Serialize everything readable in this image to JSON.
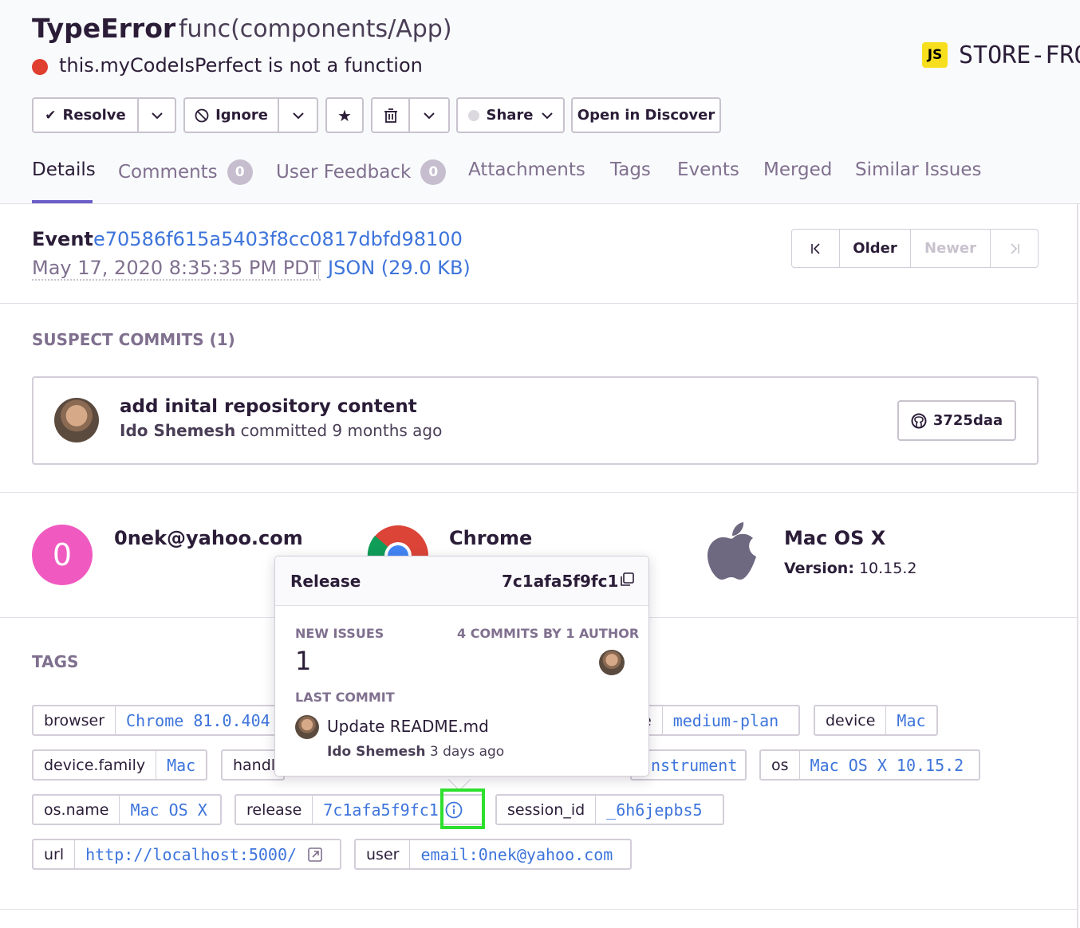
{
  "header": {
    "error_type": "TypeError",
    "culprit": "func(components/App)",
    "message": "this.myCodeIsPerfect is not a function",
    "project_badge": "JS",
    "project_name": "STORE-FRO"
  },
  "actions": {
    "resolve": "Resolve",
    "ignore": "Ignore",
    "share": "Share",
    "open_in_discover": "Open in Discover"
  },
  "tabs": [
    {
      "label": "Details"
    },
    {
      "label": "Comments",
      "count": "0"
    },
    {
      "label": "User Feedback",
      "count": "0"
    },
    {
      "label": "Attachments"
    },
    {
      "label": "Tags"
    },
    {
      "label": "Events"
    },
    {
      "label": "Merged"
    },
    {
      "label": "Similar Issues"
    }
  ],
  "event": {
    "label": "Event",
    "id": "e70586f615a5403f8cc0817dbfd98100",
    "date": "May 17, 2020 8:35:35 PM PDT",
    "json_link": "JSON (29.0 KB)",
    "pager": {
      "older": "Older",
      "newer": "Newer"
    }
  },
  "suspect_commits": {
    "title": "SUSPECT COMMITS (1)",
    "commit": {
      "message": "add inital repository content",
      "author": "Ido Shemesh",
      "when": "committed 9 months ago",
      "sha": "3725daa"
    }
  },
  "context": {
    "user": {
      "initial": "0",
      "email": "0nek@yahoo.com"
    },
    "browser": {
      "name": "Chrome"
    },
    "os": {
      "name": "Mac OS X",
      "version_label": "Version:",
      "version": "10.15.2"
    }
  },
  "tags": {
    "title": "TAGS",
    "items": [
      {
        "key": "browser",
        "value": "Chrome 81.0.404"
      },
      {
        "key": "e",
        "value": "medium-plan"
      },
      {
        "key": "device",
        "value": "Mac"
      },
      {
        "key": "device.family",
        "value": "Mac"
      },
      {
        "key": "handl",
        "value": ""
      },
      {
        "key": "",
        "value": "nstrument"
      },
      {
        "key": "os",
        "value": "Mac OS X 10.15.2"
      },
      {
        "key": "os.name",
        "value": "Mac OS X"
      },
      {
        "key": "release",
        "value": "7c1afa5f9fc1"
      },
      {
        "key": "session_id",
        "value": "_6h6jepbs5"
      },
      {
        "key": "url",
        "value": "http://localhost:5000/"
      },
      {
        "key": "user",
        "value": "email:0nek@yahoo.com"
      }
    ]
  },
  "release_popover": {
    "title": "Release",
    "version": "7c1afa5f9fc1",
    "new_issues_label": "NEW ISSUES",
    "new_issues_count": "1",
    "commits_label": "4 COMMITS BY 1 AUTHOR",
    "last_commit_label": "LAST COMMIT",
    "last_commit_message": "Update README.md",
    "last_commit_author": "Ido Shemesh",
    "last_commit_when": "3 days ago"
  },
  "colors": {
    "accent": "#6c5fc7",
    "link": "#3d74db",
    "error_dot": "#e03e2f",
    "user_avatar": "#f05ac0",
    "focus_highlight": "#2ee02e"
  }
}
